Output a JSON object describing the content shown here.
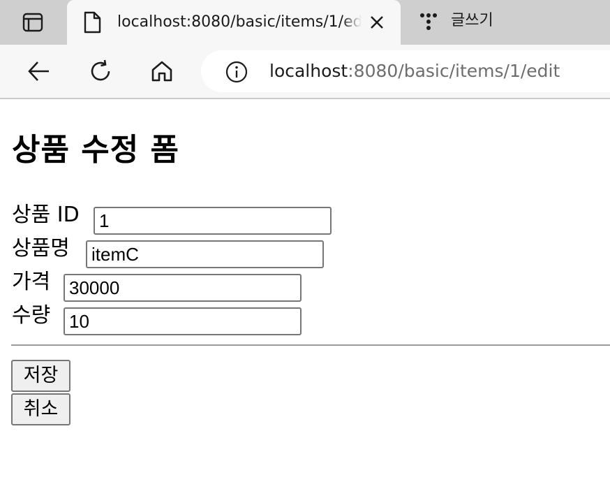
{
  "browser": {
    "tabs": [
      {
        "title": "localhost:8080/basic/items/1/edit",
        "active": true
      },
      {
        "title": "글쓰기",
        "active": false
      }
    ],
    "url": {
      "host": "localhost",
      "rest": ":8080/basic/items/1/edit"
    }
  },
  "icons": {
    "tab_actions": "tab-actions-icon",
    "page": "page-document-icon",
    "close": "close-icon",
    "inactive_favicon": "dots-favicon-icon",
    "back": "back-arrow-icon",
    "reload": "reload-icon",
    "home": "home-icon",
    "info": "site-info-icon"
  },
  "page": {
    "title": "상품 수정 폼",
    "fields": [
      {
        "label": "상품 ID",
        "value": "1"
      },
      {
        "label": "상품명",
        "value": "itemC"
      },
      {
        "label": "가격",
        "value": "30000"
      },
      {
        "label": "수량",
        "value": "10"
      }
    ],
    "buttons": {
      "save": "저장",
      "cancel": "취소"
    }
  }
}
